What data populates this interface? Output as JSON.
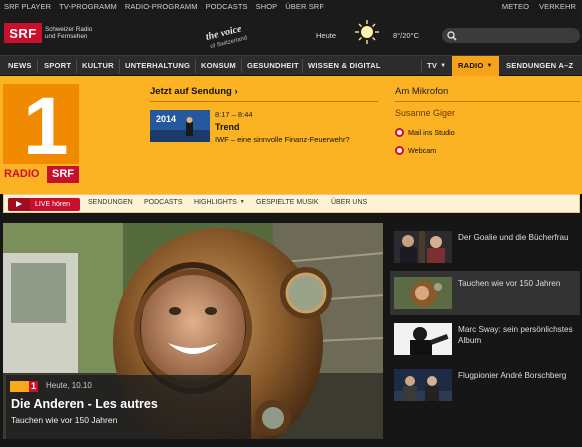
{
  "topbar": {
    "left_links": [
      "SRF PLAYER",
      "TV-PROGRAMM",
      "RADIO-PROGRAMM",
      "PODCASTS",
      "SHOP",
      "ÜBER SRF"
    ],
    "right_links": [
      "METEO",
      "VERKEHR"
    ]
  },
  "header": {
    "logo": "SRF",
    "logo_text_line1": "Schweizer Radio",
    "logo_text_line2": "und Fernsehen",
    "voice_logo": "The Voice of Switzerland",
    "weather_label": "Heute",
    "temperature": "8°/20°C",
    "search_placeholder": ""
  },
  "nav": {
    "items": [
      "NEWS",
      "SPORT",
      "KULTUR",
      "UNTERHALTUNG",
      "KONSUM",
      "GESUNDHEIT",
      "WISSEN & DIGITAL"
    ],
    "right_items": [
      "TV",
      "RADIO",
      "SENDUNGEN A–Z"
    ],
    "active": "RADIO"
  },
  "station": {
    "number": "1",
    "radio_word": "RADIO",
    "srf_word": "SRF"
  },
  "now_playing": {
    "heading": "Jetzt auf Sendung",
    "thumb_year": "2014",
    "time": "8:17 – 8:44",
    "show": "Trend",
    "description": "IWF – eine sinnvolle Finanz-Feuerwehr?"
  },
  "microphone": {
    "heading": "Am Mikrofon",
    "host": "Susanne Giger",
    "mail_link": "Mail ins Studio",
    "webcam_link": "Webcam"
  },
  "subnav": {
    "live_label": "LIVE hören",
    "items": [
      "SENDUNGEN",
      "PODCASTS",
      "HIGHLIGHTS",
      "GESPIELTE MUSIK",
      "ÜBER UNS"
    ]
  },
  "hero": {
    "badge_number": "1",
    "time": "Heute, 10.10",
    "title": "Die Anderen - Les autres",
    "subtitle": "Tauchen wie vor 150 Jahren"
  },
  "side_items": [
    {
      "text": "Der Goalie und die Bücherfrau",
      "icon": "people-photo"
    },
    {
      "text": "Tauchen wie vor 150 Jahren",
      "icon": "diver-photo"
    },
    {
      "text": "Marc Sway: sein persönlichstes Album",
      "icon": "musician-photo"
    },
    {
      "text": "Flugpionier André Borschberg",
      "icon": "aviator-photo"
    }
  ],
  "colors": {
    "brand_red": "#c8102e",
    "radio_orange": "#f7a81c",
    "dark_bg": "#161616"
  }
}
